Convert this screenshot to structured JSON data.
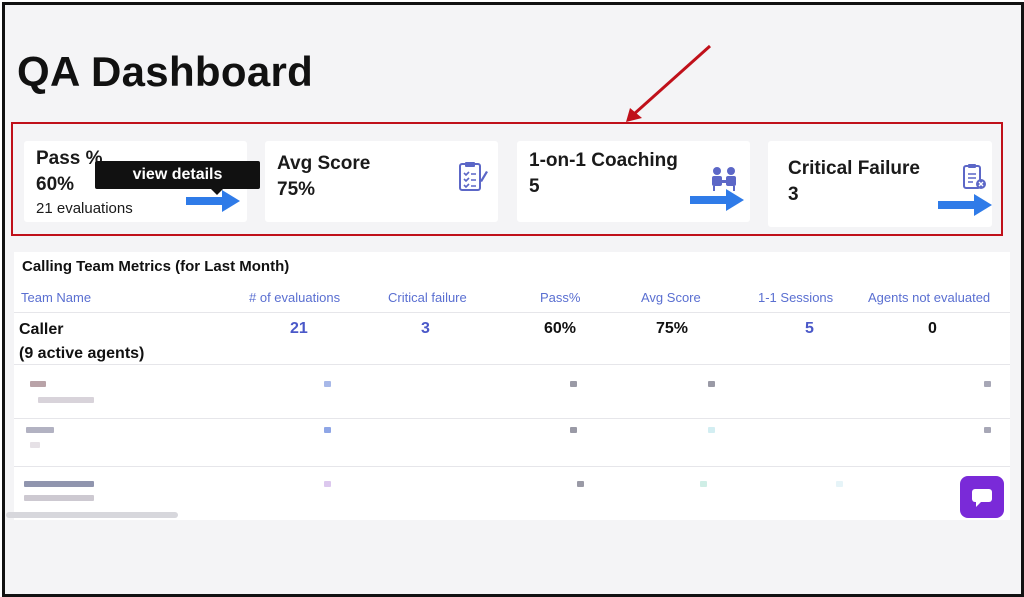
{
  "page": {
    "title": "QA Dashboard"
  },
  "colors": {
    "accent": "#2f7be8",
    "highlight": "#c0101a",
    "link": "#4a58c8",
    "chat": "#7a2ad8"
  },
  "cards": [
    {
      "label": "Pass %",
      "value": "60%",
      "sub": "21 evaluations",
      "icon": "arrow-right-icon"
    },
    {
      "label": "Avg Score",
      "value": "75%",
      "icon": "checklist-icon"
    },
    {
      "label": "1-on-1 Coaching",
      "value": "5",
      "icon": "coaching-icon"
    },
    {
      "label": "Critical Failure",
      "value": "3",
      "icon": "clipboard-alert-icon"
    }
  ],
  "tooltip": {
    "text": "view details"
  },
  "metrics": {
    "title": "Calling Team Metrics (for Last Month)",
    "headers": [
      "Team Name",
      "# of evaluations",
      "Critical failure",
      "Pass%",
      "Avg Score",
      "1-1 Sessions",
      "Agents not evaluated"
    ],
    "row": {
      "team": "Caller",
      "agents": "(9 active agents)",
      "evaluations": "21",
      "critical": "3",
      "pass": "60%",
      "avg": "75%",
      "sessions": "5",
      "not_evaluated": "0"
    }
  },
  "chat": {
    "icon": "chat-icon"
  }
}
